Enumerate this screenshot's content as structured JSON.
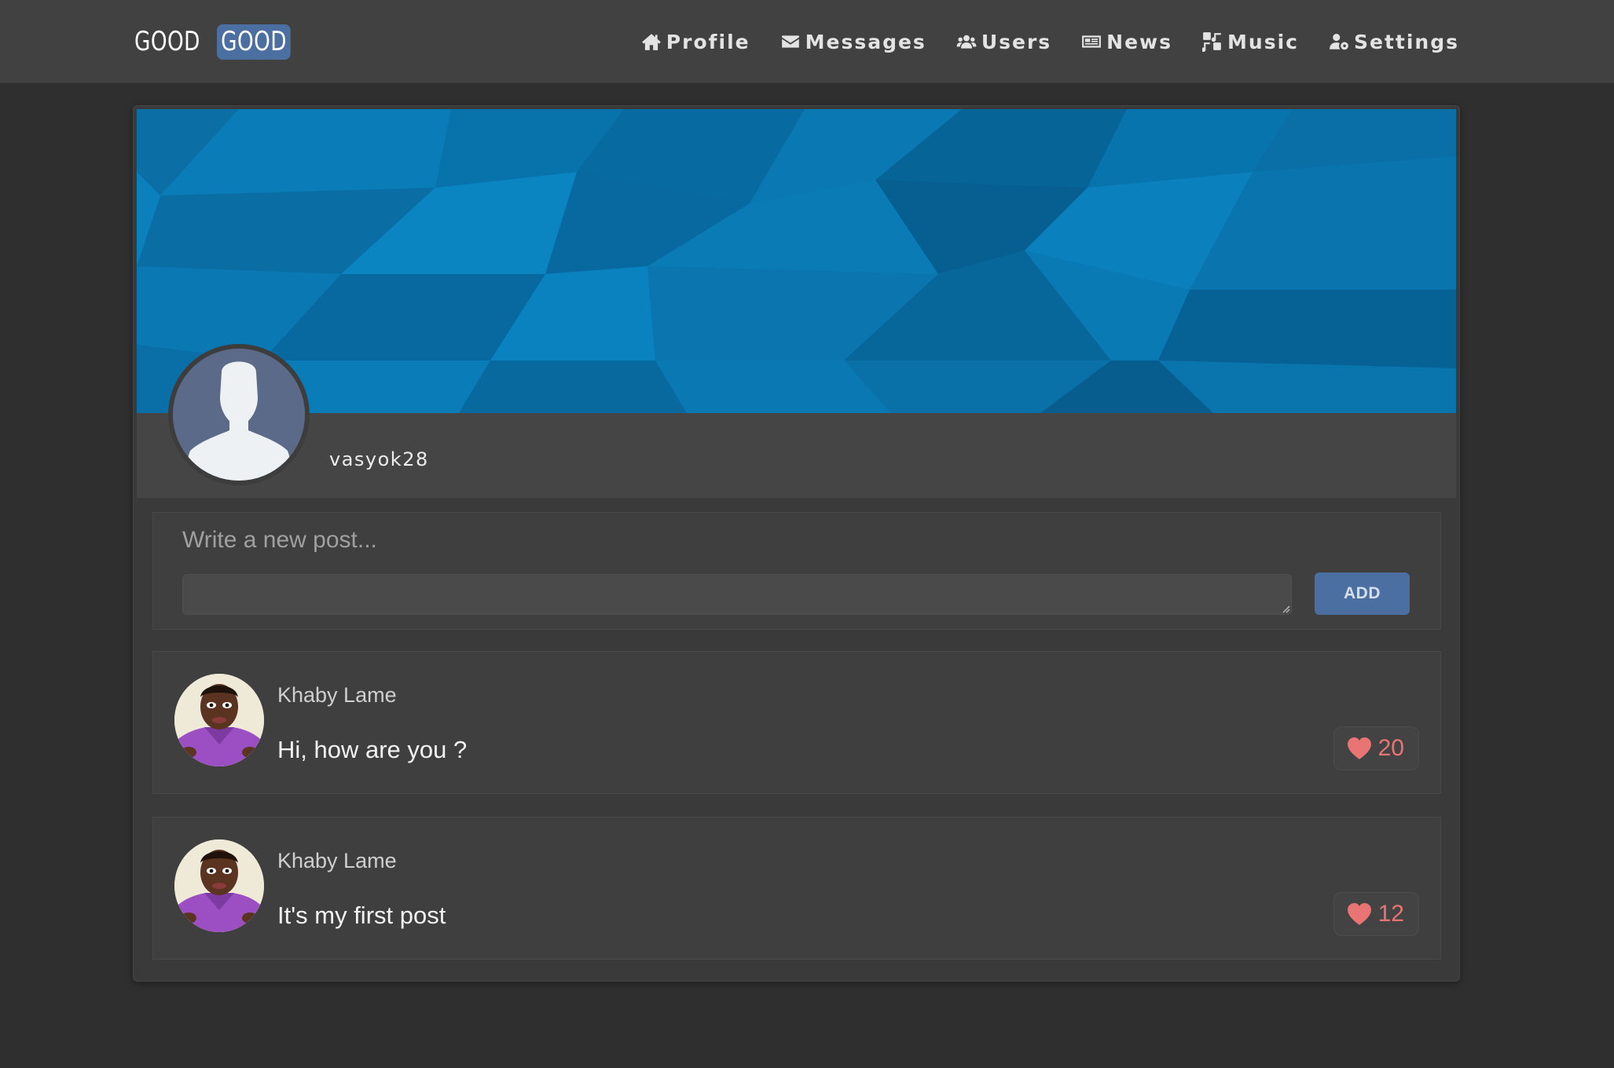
{
  "brand": {
    "part1": "GOOD",
    "part2": "GOOD",
    "accent": "#4a6fa0"
  },
  "nav": [
    {
      "label": "Profile",
      "icon": "home-icon"
    },
    {
      "label": "Messages",
      "icon": "envelope-icon"
    },
    {
      "label": "Users",
      "icon": "users-icon"
    },
    {
      "label": "News",
      "icon": "newspaper-icon"
    },
    {
      "label": "Music",
      "icon": "music-icon"
    },
    {
      "label": "Settings",
      "icon": "user-cog-icon"
    }
  ],
  "profile": {
    "username": "vasyok28"
  },
  "composer": {
    "title": "Write a new post...",
    "value": "",
    "button_label": "ADD"
  },
  "posts": [
    {
      "author": "Khaby Lame",
      "text": "Hi, how are you ?",
      "likes": "20"
    },
    {
      "author": "Khaby Lame",
      "text": "It's my first post",
      "likes": "12"
    }
  ],
  "colors": {
    "like": "#e87474",
    "cover": "#0a74ab",
    "background": "#2f2f2f"
  }
}
